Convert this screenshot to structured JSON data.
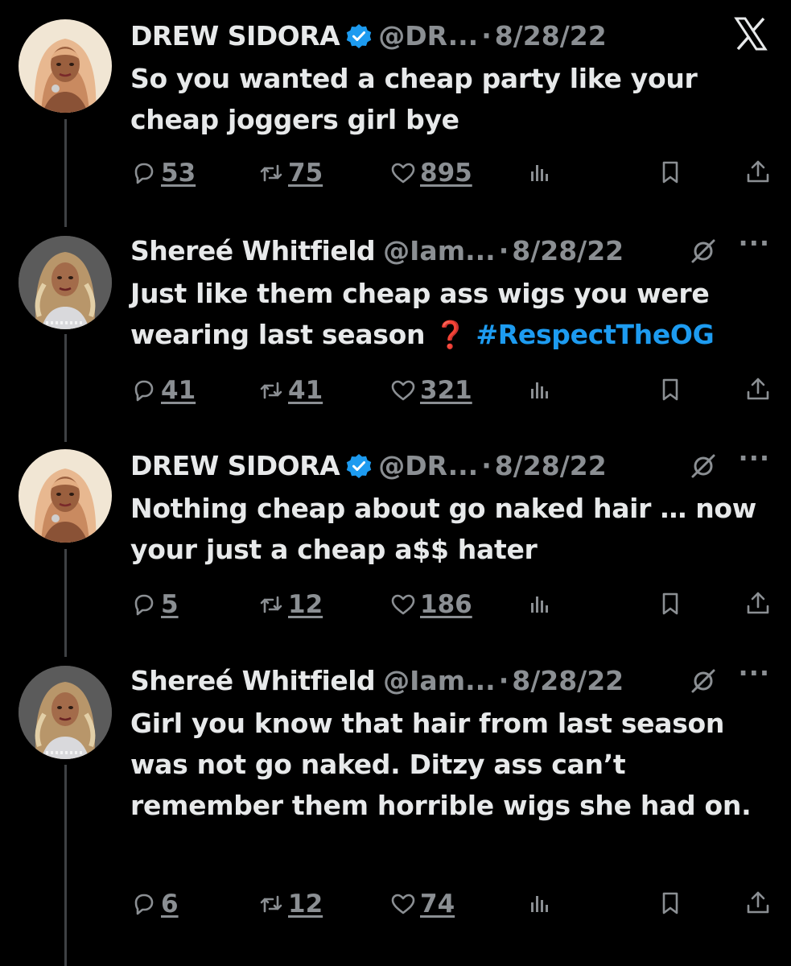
{
  "close_glyph": "X",
  "tweets": [
    {
      "name": "DREW SIDORA",
      "verified": true,
      "handle": "@DR...",
      "date": "8/28/22",
      "text": "So you wanted a cheap party like your cheap joggers girl bye",
      "replies": "53",
      "retweets": "75",
      "likes": "895"
    },
    {
      "name": "Shereé Whitfield",
      "verified": false,
      "handle": "@Iam...",
      "date": "8/28/22",
      "text_before": "Just like them cheap ass wigs you were wearing last season",
      "emoji": "❓",
      "hashtag": "#RespectTheOG",
      "replies": "41",
      "retweets": "41",
      "likes": "321"
    },
    {
      "name": "DREW SIDORA",
      "verified": true,
      "handle": "@DR...",
      "date": "8/28/22",
      "text": "Nothing cheap about go naked hair … now your just a cheap a$$ hater",
      "replies": "5",
      "retweets": "12",
      "likes": "186"
    },
    {
      "name": "Shereé Whitfield",
      "verified": false,
      "handle": "@Iam...",
      "date": "8/28/22",
      "text": "Girl you know that hair from last season was not go naked. Ditzy ass can’t remember them horrible wigs she had on.",
      "replies": "6",
      "retweets": "12",
      "likes": "74"
    }
  ],
  "sep": "·",
  "more": "···",
  "colors": {
    "background": "#000000",
    "text": "#e7e9ea",
    "muted": "#8b8f93",
    "link": "#1d9bf0",
    "verified": "#1d9bf0",
    "thread_line": "#3e4144"
  },
  "icons": [
    "x-logo-icon",
    "verified-badge-icon",
    "grok-icon",
    "more-icon",
    "reply-icon",
    "retweet-icon",
    "like-icon",
    "views-icon",
    "bookmark-icon",
    "share-icon"
  ]
}
